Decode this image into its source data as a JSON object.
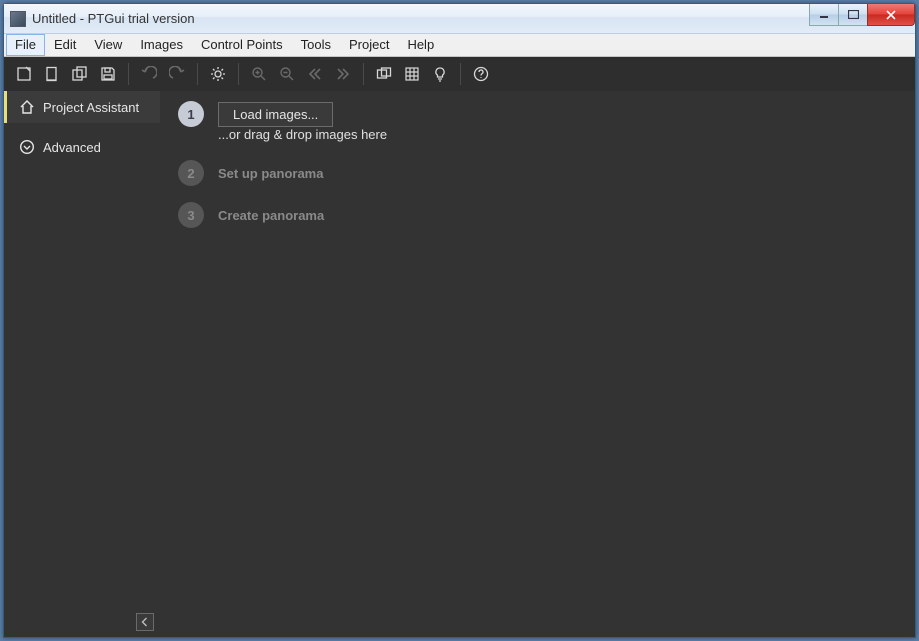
{
  "window": {
    "title": "Untitled - PTGui trial version"
  },
  "menu": {
    "file": "File",
    "edit": "Edit",
    "view": "View",
    "images": "Images",
    "control_points": "Control Points",
    "tools": "Tools",
    "project": "Project",
    "help": "Help"
  },
  "toolbar": {
    "new": "new-project-icon",
    "open": "open-icon",
    "save": "save-icon",
    "saveas": "save-as-icon",
    "undo": "undo-icon",
    "redo": "redo-icon",
    "settings": "settings-icon",
    "zoomin": "zoom-in-icon",
    "zoomout": "zoom-out-icon",
    "prev": "prev-icon",
    "next": "next-icon",
    "pano": "panorama-editor-icon",
    "grid": "detail-viewer-icon",
    "bulb": "tips-icon",
    "help": "help-icon"
  },
  "sidebar": {
    "items": [
      {
        "label": "Project Assistant"
      },
      {
        "label": "Advanced"
      }
    ]
  },
  "steps": {
    "s1": {
      "num": "1",
      "button": "Load images...",
      "hint": "...or drag & drop images here"
    },
    "s2": {
      "num": "2",
      "label": "Set up panorama"
    },
    "s3": {
      "num": "3",
      "label": "Create panorama"
    }
  }
}
